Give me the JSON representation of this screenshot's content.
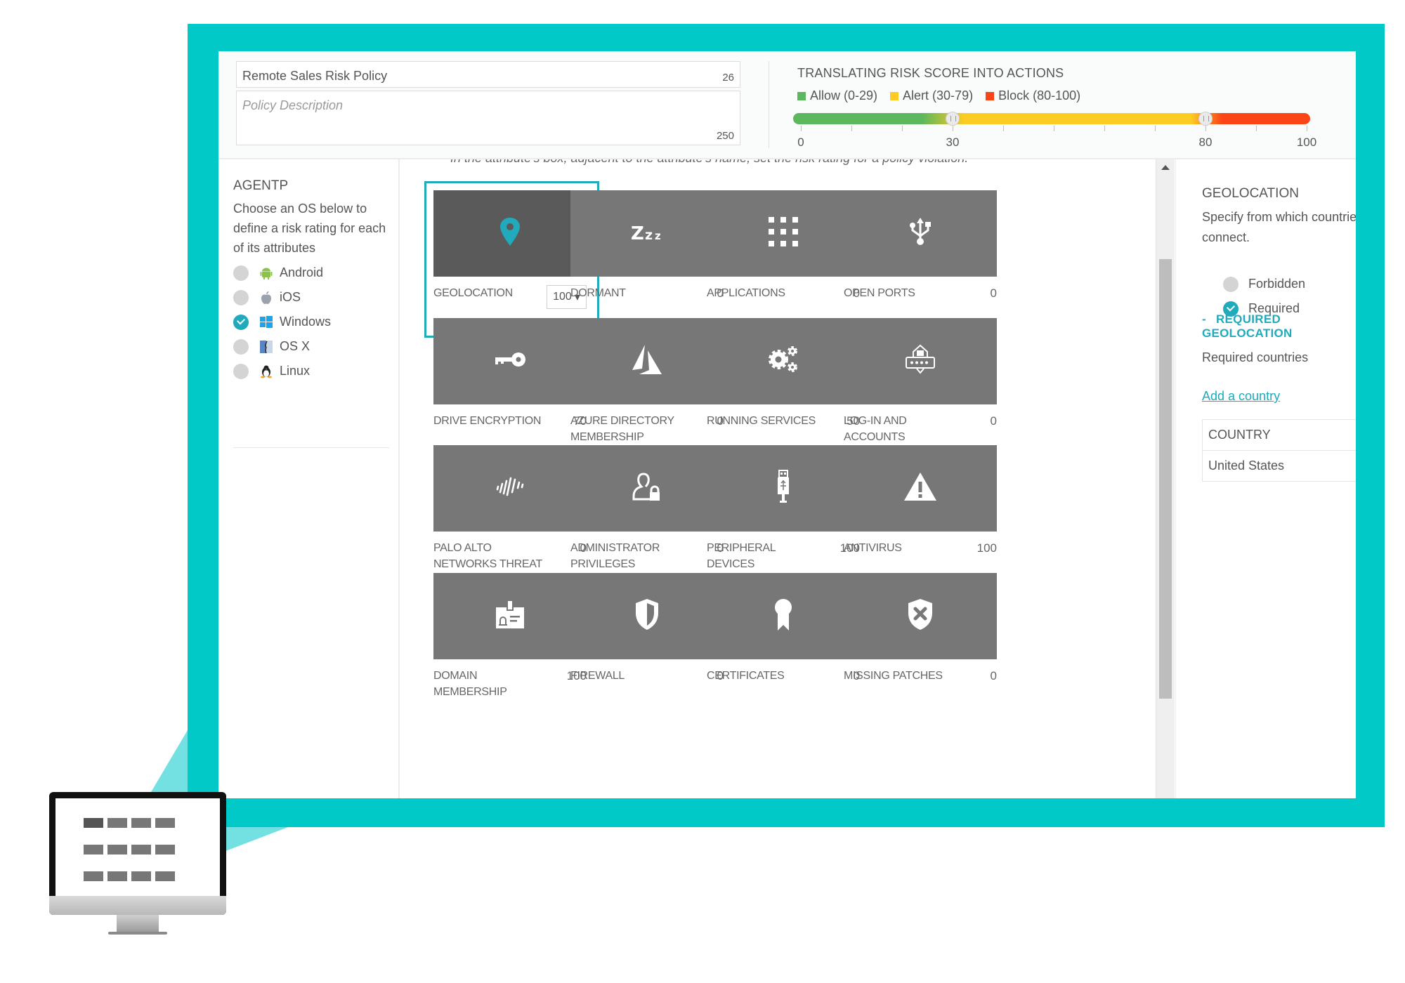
{
  "header": {
    "policy_name": "Remote Sales Risk Policy",
    "policy_name_count": "26",
    "policy_description_placeholder": "Policy Description",
    "policy_description_count": "250",
    "risk_title": "TRANSLATING RISK SCORE INTO ACTIONS",
    "legend": [
      {
        "label": "Allow (0-29)",
        "color": "#5cb85c"
      },
      {
        "label": "Alert (30-79)",
        "color": "#fccb24"
      },
      {
        "label": "Block (80-100)",
        "color": "#fb4517"
      }
    ],
    "slider": {
      "min": 0,
      "max": 100,
      "thresholds": [
        30,
        80
      ],
      "tick_labels": [
        {
          "value": 0,
          "label": "0"
        },
        {
          "value": 30,
          "label": "30"
        },
        {
          "value": 80,
          "label": "80"
        },
        {
          "value": 100,
          "label": "100"
        }
      ]
    }
  },
  "sidebar": {
    "title": "AGENTP",
    "description": "Choose an OS below to define a risk rating for each of its attributes",
    "os_options": [
      {
        "label": "Android",
        "icon": "android-icon",
        "selected": false
      },
      {
        "label": "iOS",
        "icon": "apple-icon",
        "selected": false
      },
      {
        "label": "Windows",
        "icon": "windows-icon",
        "selected": true
      },
      {
        "label": "OS X",
        "icon": "finder-icon",
        "selected": false
      },
      {
        "label": "Linux",
        "icon": "linux-tux-icon",
        "selected": false
      }
    ]
  },
  "main": {
    "hint": "In the attribute's box, adjacent to the attribute's name, set the risk rating for a policy violation.",
    "attributes": [
      {
        "label": "GEOLOCATION",
        "value": "100",
        "icon": "map-pin-icon",
        "selected": true
      },
      {
        "label": "DORMANT",
        "value": "0",
        "icon": "sleep-zzz-icon"
      },
      {
        "label": "APPLICATIONS",
        "value": "0",
        "icon": "app-grid-icon"
      },
      {
        "label": "OPEN PORTS",
        "value": "0",
        "icon": "usb-icon"
      },
      {
        "label": "DRIVE ENCRYPTION",
        "value": "70",
        "icon": "key-icon"
      },
      {
        "label": "AZURE DIRECTORY MEMBERSHIP",
        "value": "0",
        "icon": "azure-icon"
      },
      {
        "label": "RUNNING SERVICES",
        "value": "50",
        "icon": "gears-icon"
      },
      {
        "label": "LOG-IN AND ACCOUNTS",
        "value": "0",
        "icon": "login-password-icon"
      },
      {
        "label": "PALO ALTO NETWORKS THREAT DETECTION",
        "value": "0",
        "icon": "threat-wave-icon"
      },
      {
        "label": "ADMINISTRATOR PRIVILEGES",
        "value": "0",
        "icon": "admin-user-lock-icon"
      },
      {
        "label": "PERIPHERAL DEVICES",
        "value": "100",
        "icon": "usb-drive-icon"
      },
      {
        "label": "ANTIVIRUS",
        "value": "100",
        "icon": "warning-triangle-icon"
      },
      {
        "label": "DOMAIN MEMBERSHIP",
        "value": "100",
        "icon": "id-badge-icon"
      },
      {
        "label": "FIREWALL",
        "value": "0",
        "icon": "shield-icon"
      },
      {
        "label": "CERTIFICATES",
        "value": "0",
        "icon": "certificate-ribbon-icon"
      },
      {
        "label": "MISSING PATCHES",
        "value": "0",
        "icon": "shield-x-icon"
      }
    ]
  },
  "right_panel": {
    "title": "GEOLOCATION",
    "description_line1": "Specify from which countries i",
    "description_line2": "connect.",
    "options": [
      {
        "label": "Forbidden",
        "selected": false
      },
      {
        "label": "Required",
        "selected": true
      }
    ],
    "section_toggle": "-",
    "section_title": "REQUIRED GEOLOCATION",
    "required_label": "Required countries",
    "add_link": "Add a country",
    "table": {
      "header": "COUNTRY",
      "rows": [
        "United States"
      ]
    }
  },
  "colors": {
    "frame": "#00c9c8",
    "accent": "#20aabb",
    "tile": "#777777",
    "tile_selected": "#5a5a5a"
  }
}
